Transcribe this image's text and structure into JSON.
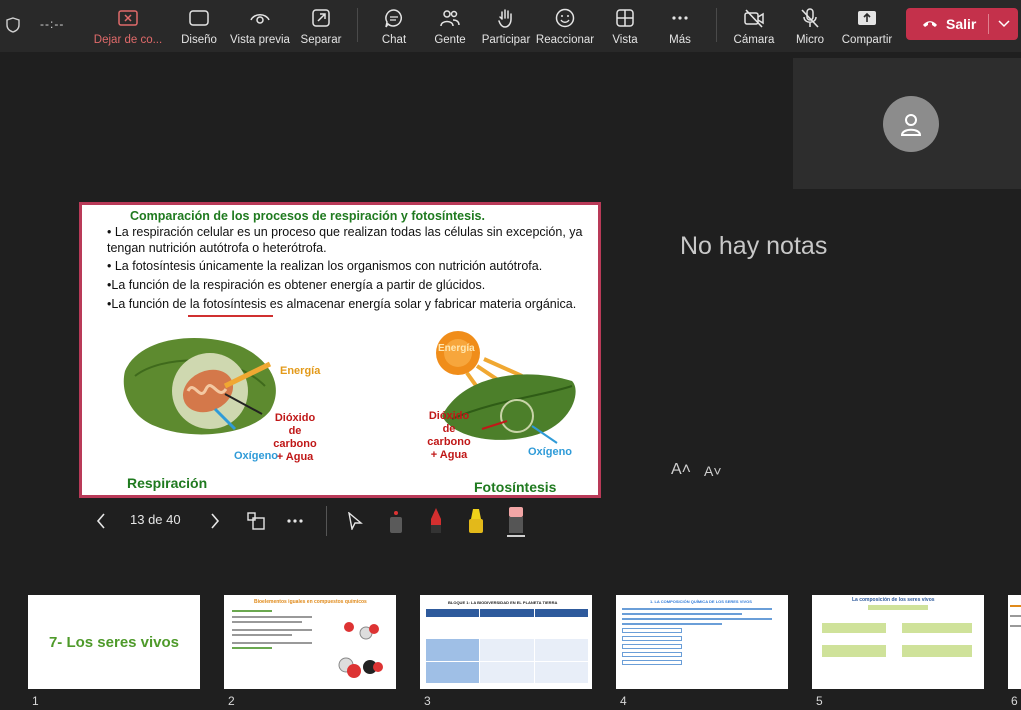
{
  "toolbar": {
    "time": "--:--",
    "buttons": [
      {
        "label": "Dejar de co...",
        "icon": "stop-sharing-icon"
      },
      {
        "label": "Diseño",
        "icon": "layout-icon"
      },
      {
        "label": "Vista previa",
        "icon": "preview-icon"
      },
      {
        "label": "Separar",
        "icon": "popout-icon"
      },
      {
        "label": "Chat",
        "icon": "chat-icon"
      },
      {
        "label": "Gente",
        "icon": "people-icon"
      },
      {
        "label": "Participar",
        "icon": "raise-hand-icon"
      },
      {
        "label": "Reaccionar",
        "icon": "react-icon"
      },
      {
        "label": "Vista",
        "icon": "view-icon"
      },
      {
        "label": "Más",
        "icon": "more-icon"
      },
      {
        "label": "Cámara",
        "icon": "camera-off-icon"
      },
      {
        "label": "Micro",
        "icon": "mic-off-icon"
      },
      {
        "label": "Compartir",
        "icon": "share-icon"
      }
    ],
    "leave_label": "Salir",
    "leave_color": "#c4314b"
  },
  "slide": {
    "title": "Comparación de los procesos de respiración y fotosíntesis.",
    "bullets": [
      "• La respiración celular es un proceso que realizan todas las células sin excepción, ya tengan nutrición autótrofa o heterótrofa.",
      "• La fotosíntesis únicamente la realizan los organismos con nutrición autótrofa.",
      "•La función de la respiración es obtener energía a partir de glúcidos.",
      "•La función de la fotosíntesis es almacenar energía solar y fabricar materia orgánica."
    ],
    "left": {
      "energia": "Energía",
      "dioxido": "Dióxido de carbono + Agua",
      "oxigeno": "Oxígeno",
      "caption": "Respiración"
    },
    "right": {
      "energia": "Energía",
      "dioxido": "Dióxido de carbono + Agua",
      "oxigeno": "Oxígeno",
      "caption": "Fotosíntesis"
    }
  },
  "presenter": {
    "page": "13 de 40",
    "notes": "No hay notas",
    "font_increase": "A˄",
    "font_decrease": "A˅"
  },
  "thumbnails": [
    {
      "number": "1",
      "title": "7- Los seres vivos"
    },
    {
      "number": "2",
      "title": "Bioelementos iguales en compuestos químicos"
    },
    {
      "number": "3",
      "title": "BLOQUE 1: LA BIODIVERSIDAD EN EL PLANETA TIERRA"
    },
    {
      "number": "4",
      "title": "1. LA COMPOSICIÓN QUÍMICA DE LOS SERES VIVOS"
    },
    {
      "number": "5",
      "title": "La composición de los seres vivos"
    },
    {
      "number": "6",
      "title": ""
    }
  ]
}
